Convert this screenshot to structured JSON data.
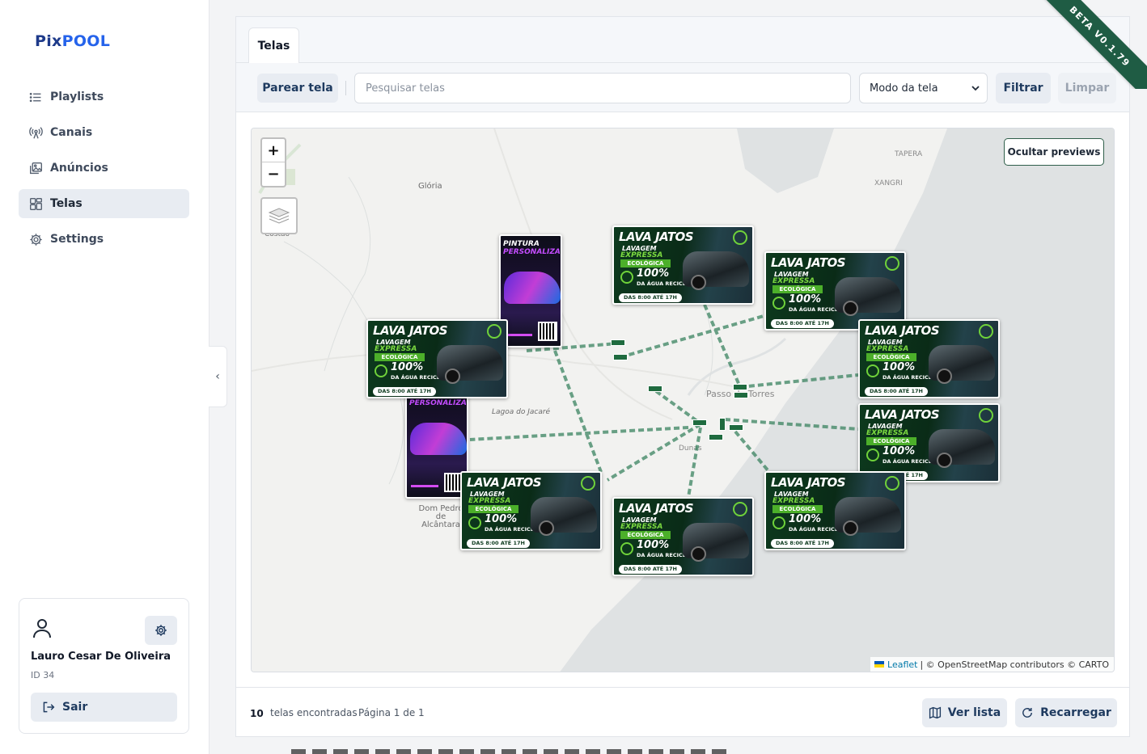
{
  "app": {
    "logo_pix": "Pix",
    "logo_pool": "POOL",
    "beta_label": "BETA V0.1.79"
  },
  "sidebar": {
    "items": [
      {
        "label": "Playlists",
        "icon": "list-icon",
        "active": false
      },
      {
        "label": "Canais",
        "icon": "broadcast-icon",
        "active": false
      },
      {
        "label": "Anúncios",
        "icon": "images-icon",
        "active": false
      },
      {
        "label": "Telas",
        "icon": "layout-icon",
        "active": true
      },
      {
        "label": "Settings",
        "icon": "gear-icon",
        "active": false
      }
    ]
  },
  "user": {
    "name": "Lauro Cesar De Oliveira",
    "id_label": "ID 34",
    "logout_label": "Sair"
  },
  "main": {
    "tab_label": "Telas",
    "toolbar": {
      "pair_label": "Parear tela",
      "search_placeholder": "Pesquisar telas",
      "mode_select_value": "Modo da tela",
      "filter_label": "Filtrar",
      "clear_label": "Limpar"
    },
    "map": {
      "zoom_in": "+",
      "zoom_out": "−",
      "hide_previews_label": "Ocultar previews",
      "attribution_link": "Leaflet",
      "attribution_text": "| © OpenStreetMap contributors © CARTO",
      "place_labels": [
        {
          "text": "Glória"
        },
        {
          "text": "Costão"
        },
        {
          "text": "TAPERA"
        },
        {
          "text": "XANGRI"
        },
        {
          "text": "Lagoa do Jacaré"
        },
        {
          "text": "Passo de Torres"
        },
        {
          "text": "Dom Pedro de Alcântara"
        },
        {
          "text": "Dunas"
        }
      ],
      "preview_ad_lava": {
        "title": "LAVA JATOS",
        "line1": "LAVAGEM",
        "line2": "EXPRESSA",
        "line3": "ECOLÓGICA",
        "line4": "100%",
        "line5": "DA ÁGUA RECICLADA!",
        "hours": "DAS 8:00 ATÉ 17H"
      },
      "preview_ad_pintura": {
        "line1": "PINTURA",
        "line2": "PERSONALIZADA"
      }
    },
    "footer": {
      "count": "10",
      "count_label": "telas encontradas",
      "page_label": "Página 1 de 1",
      "list_label": "Ver lista",
      "reload_label": "Recarregar"
    }
  },
  "colors": {
    "accent": "#1e3a5f",
    "brand_dark": "#1e3a8a",
    "brand": "#2563eb",
    "beta_ribbon": "#1f5c44",
    "marker": "#1f6b3f",
    "sea": "#dfe2e3",
    "land": "#f2f2f0"
  }
}
